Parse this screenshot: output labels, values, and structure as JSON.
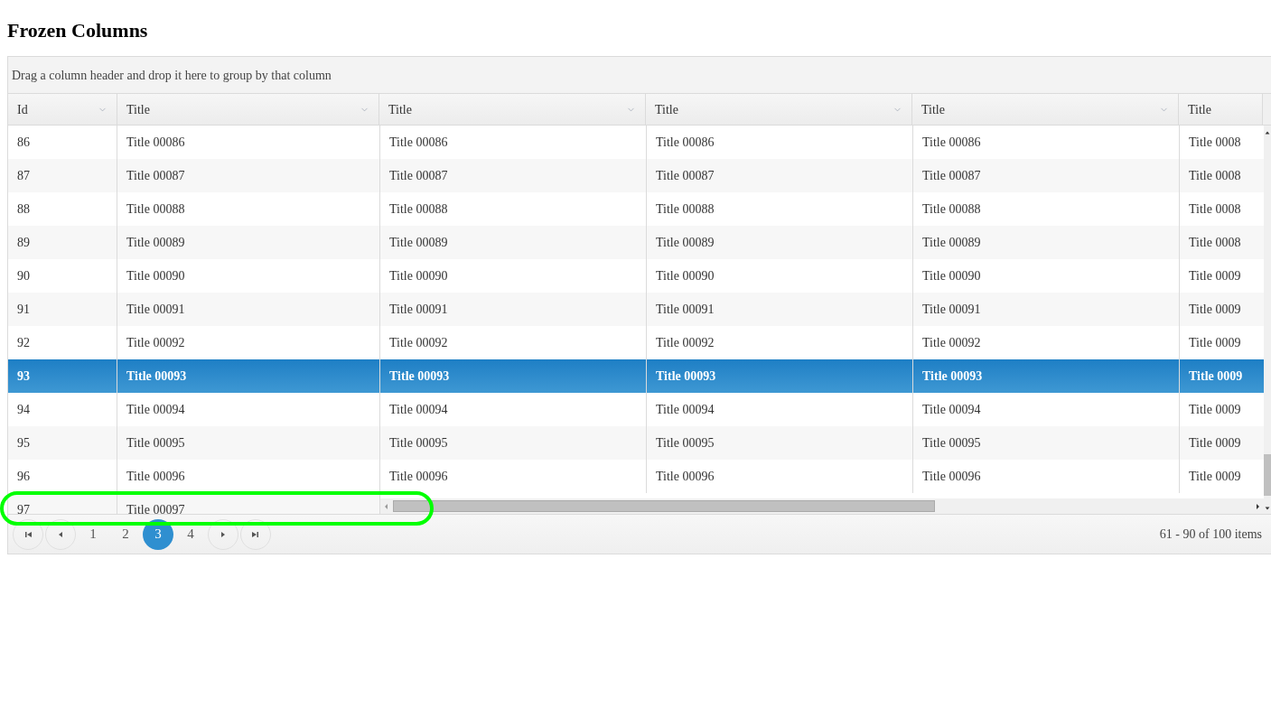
{
  "page_title": "Frozen Columns",
  "group_panel": {
    "hint": "Drag a column header and drop it here to group by that column"
  },
  "columns": [
    {
      "label": "Id",
      "frozen": true,
      "menu": true
    },
    {
      "label": "Title",
      "frozen": true,
      "menu": true
    },
    {
      "label": "Title",
      "frozen": false,
      "menu": true
    },
    {
      "label": "Title",
      "frozen": false,
      "menu": true
    },
    {
      "label": "Title",
      "frozen": false,
      "menu": true
    },
    {
      "label": "Title",
      "frozen": false,
      "menu": false
    }
  ],
  "rows": [
    {
      "cells": [
        "86",
        "Title 00086",
        "Title 00086",
        "Title 00086",
        "Title 00086",
        "Title 0008"
      ],
      "selected": false
    },
    {
      "cells": [
        "87",
        "Title 00087",
        "Title 00087",
        "Title 00087",
        "Title 00087",
        "Title 0008"
      ],
      "selected": false
    },
    {
      "cells": [
        "88",
        "Title 00088",
        "Title 00088",
        "Title 00088",
        "Title 00088",
        "Title 0008"
      ],
      "selected": false
    },
    {
      "cells": [
        "89",
        "Title 00089",
        "Title 00089",
        "Title 00089",
        "Title 00089",
        "Title 0008"
      ],
      "selected": false
    },
    {
      "cells": [
        "90",
        "Title 00090",
        "Title 00090",
        "Title 00090",
        "Title 00090",
        "Title 0009"
      ],
      "selected": false
    },
    {
      "cells": [
        "91",
        "Title 00091",
        "Title 00091",
        "Title 00091",
        "Title 00091",
        "Title 0009"
      ],
      "selected": false
    },
    {
      "cells": [
        "92",
        "Title 00092",
        "Title 00092",
        "Title 00092",
        "Title 00092",
        "Title 0009"
      ],
      "selected": false
    },
    {
      "cells": [
        "93",
        "Title 00093",
        "Title 00093",
        "Title 00093",
        "Title 00093",
        "Title 0009"
      ],
      "selected": true
    },
    {
      "cells": [
        "94",
        "Title 00094",
        "Title 00094",
        "Title 00094",
        "Title 00094",
        "Title 0009"
      ],
      "selected": false
    },
    {
      "cells": [
        "95",
        "Title 00095",
        "Title 00095",
        "Title 00095",
        "Title 00095",
        "Title 0009"
      ],
      "selected": false
    },
    {
      "cells": [
        "96",
        "Title 00096",
        "Title 00096",
        "Title 00096",
        "Title 00096",
        "Title 0009"
      ],
      "selected": false
    },
    {
      "cells": [
        "97",
        "Title 00097"
      ],
      "selected": false
    }
  ],
  "pager": {
    "pages": [
      {
        "label": "1",
        "selected": false
      },
      {
        "label": "2",
        "selected": false
      },
      {
        "label": "3",
        "selected": true
      },
      {
        "label": "4",
        "selected": false
      }
    ],
    "info": "61 - 90 of 100 items"
  },
  "annotation": {
    "kind": "ellipse",
    "color": "#00ff00"
  }
}
